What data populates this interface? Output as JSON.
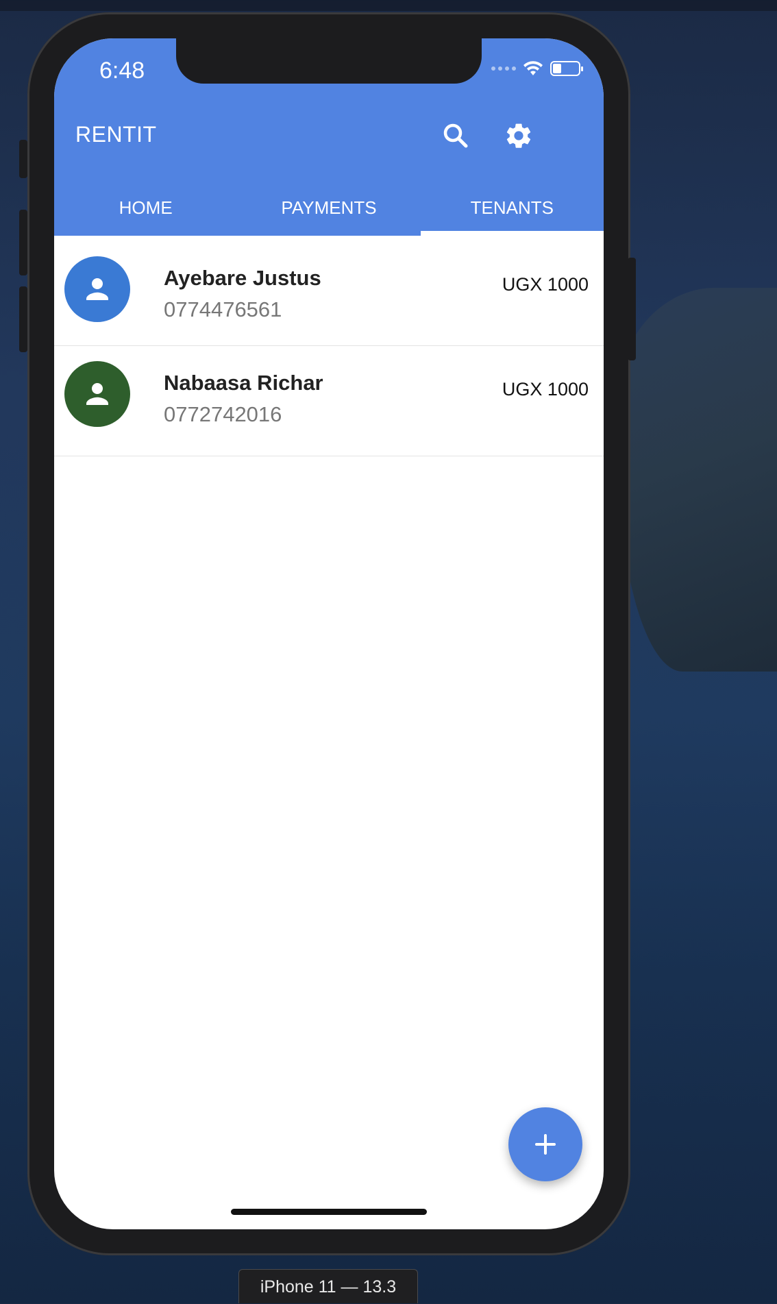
{
  "status_bar": {
    "time": "6:48"
  },
  "app_bar": {
    "title": "RENTIT",
    "color": "#5183e1",
    "icons": [
      "search-icon",
      "gear-icon"
    ]
  },
  "tabs": [
    {
      "label": "HOME",
      "active": false
    },
    {
      "label": "PAYMENTS",
      "active": false
    },
    {
      "label": "TENANTS",
      "active": true
    }
  ],
  "tenants": [
    {
      "name": "Ayebare Justus",
      "phone": "0774476561",
      "amount": "UGX 1000",
      "avatar_color": "#3a7ad4"
    },
    {
      "name": "Nabaasa Richar",
      "phone": "0772742016",
      "amount": "UGX 1000",
      "avatar_color": "#2e5e2c"
    }
  ],
  "fab": {
    "icon": "plus-icon"
  },
  "simulator": {
    "device_label": "iPhone 11 — 13.3"
  }
}
